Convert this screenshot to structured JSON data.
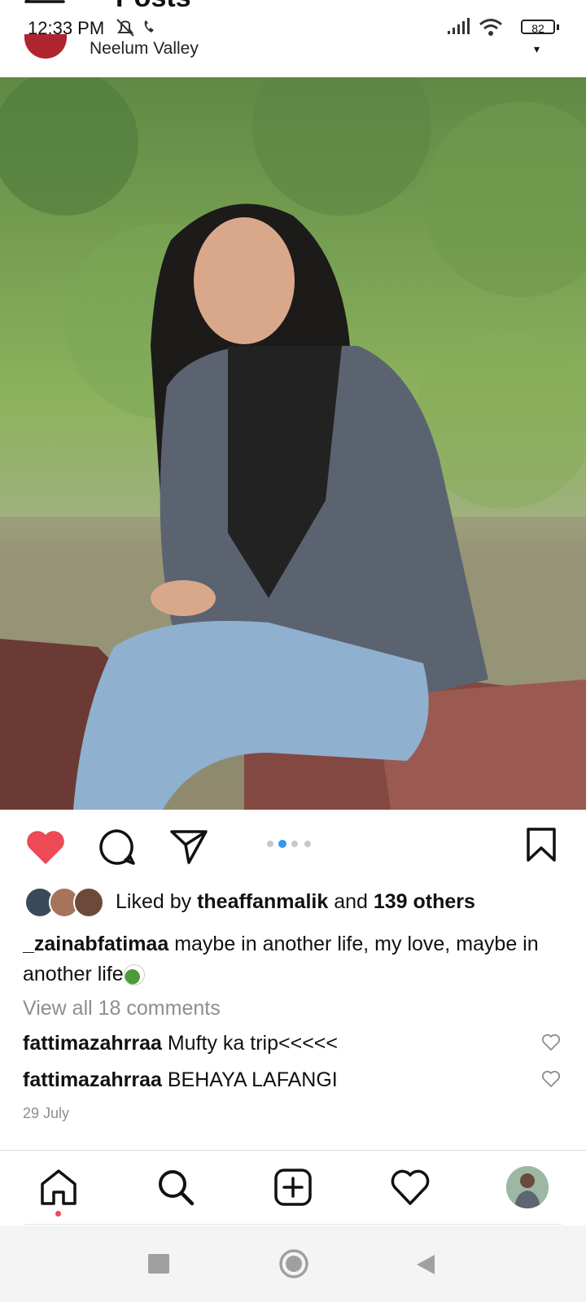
{
  "header": {
    "title": "Posts"
  },
  "status_bar": {
    "time": "12:33 PM",
    "battery": "82"
  },
  "post": {
    "location": "Neelum Valley",
    "carousel": {
      "count": 4,
      "active_index": 1
    },
    "liked_by": {
      "prefix": "Liked by",
      "user": "theaffanmalik",
      "conjunction": "and",
      "others": "139 others"
    },
    "caption": {
      "username": "_zainabfatimaa",
      "text": "maybe in another life, my love, maybe in another life"
    },
    "view_all_comments": "View all 18 comments",
    "comments": [
      {
        "username": "fattimazahrraa",
        "text": "Mufty ka trip<<<<<"
      },
      {
        "username": "fattimazahrraa",
        "text": "BEHAYA LAFANGI"
      }
    ],
    "date": "29 July"
  },
  "colors": {
    "like_red": "#ed4956",
    "active_dot": "#3897f0",
    "muted_text": "#8e8e8e"
  },
  "icons": {
    "action_bar": [
      "heart-filled-icon",
      "comment-icon",
      "share-icon",
      "bookmark-icon"
    ],
    "bottom_nav": [
      "home-icon",
      "search-icon",
      "create-icon",
      "activity-heart-icon",
      "profile-avatar"
    ],
    "system_nav": [
      "recents-icon",
      "home-circle-icon",
      "back-triangle-icon"
    ]
  }
}
